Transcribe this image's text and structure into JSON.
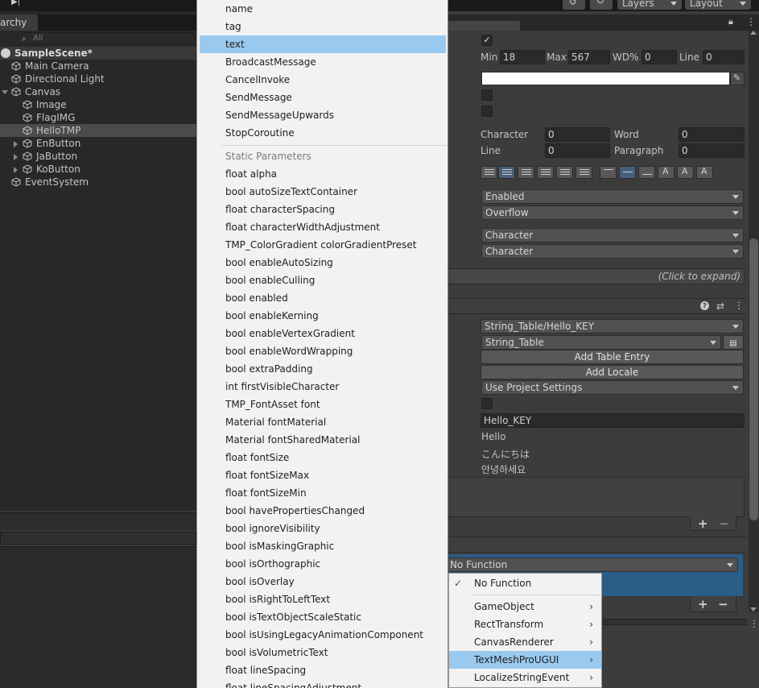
{
  "toolbar": {
    "layers_label": "Layers",
    "layout_label": "Layout"
  },
  "hierarchy": {
    "tab_label": "archy",
    "search_placeholder": "All",
    "items": [
      {
        "label": "SampleScene*"
      },
      {
        "label": "Main Camera"
      },
      {
        "label": "Directional Light"
      },
      {
        "label": "Canvas"
      },
      {
        "label": "Image"
      },
      {
        "label": "FlagIMG"
      },
      {
        "label": "HelloTMP"
      },
      {
        "label": "EnButton"
      },
      {
        "label": "JaButton"
      },
      {
        "label": "KoButton"
      },
      {
        "label": "EventSystem"
      }
    ]
  },
  "inspector": {
    "min_label": "Min",
    "min_value": "18",
    "max_label": "Max",
    "max_value": "567",
    "wd_label": "WD%",
    "wd_value": "0",
    "line_label": "Line",
    "line_value": "0",
    "character_label": "Character",
    "character_value": "0",
    "word_label": "Word",
    "word_value": "0",
    "line2_label": "Line",
    "line2_value": "0",
    "paragraph_label": "Paragraph",
    "paragraph_value": "0",
    "wrapping_value": "Enabled",
    "overflow_value": "Overflow",
    "mapping1_value": "Character",
    "mapping2_value": "Character",
    "click_to_expand": "(Click to expand)",
    "string_ref_value": "String_Table/Hello_KEY",
    "table_value": "String_Table",
    "add_table_entry": "Add Table Entry",
    "add_locale": "Add Locale",
    "project_settings_value": "Use Project Settings",
    "key_value": "Hello_KEY",
    "translation_en": "Hello",
    "translation_ja": "こんにちは",
    "translation_ko": "안녕하세요",
    "no_function_value": "No Function"
  },
  "popup": {
    "items": [
      {
        "label": "name"
      },
      {
        "label": "tag"
      },
      {
        "label": "text"
      },
      {
        "label": "BroadcastMessage"
      },
      {
        "label": "CancelInvoke"
      },
      {
        "label": "SendMessage"
      },
      {
        "label": "SendMessageUpwards"
      },
      {
        "label": "StopCoroutine"
      }
    ],
    "static_header": "Static Parameters",
    "static_items": [
      {
        "label": "float alpha"
      },
      {
        "label": "bool autoSizeTextContainer"
      },
      {
        "label": "float characterSpacing"
      },
      {
        "label": "float characterWidthAdjustment"
      },
      {
        "label": "TMP_ColorGradient colorGradientPreset"
      },
      {
        "label": "bool enableAutoSizing"
      },
      {
        "label": "bool enableCulling"
      },
      {
        "label": "bool enabled"
      },
      {
        "label": "bool enableKerning"
      },
      {
        "label": "bool enableVertexGradient"
      },
      {
        "label": "bool enableWordWrapping"
      },
      {
        "label": "bool extraPadding"
      },
      {
        "label": "int firstVisibleCharacter"
      },
      {
        "label": "TMP_FontAsset font"
      },
      {
        "label": "Material fontMaterial"
      },
      {
        "label": "Material fontSharedMaterial"
      },
      {
        "label": "float fontSize"
      },
      {
        "label": "float fontSizeMax"
      },
      {
        "label": "float fontSizeMin"
      },
      {
        "label": "bool havePropertiesChanged"
      },
      {
        "label": "bool ignoreVisibility"
      },
      {
        "label": "bool isMaskingGraphic"
      },
      {
        "label": "bool isOrthographic"
      },
      {
        "label": "bool isOverlay"
      },
      {
        "label": "bool isRightToLeftText"
      },
      {
        "label": "bool isTextObjectScaleStatic"
      },
      {
        "label": "bool isUsingLegacyAnimationComponent"
      },
      {
        "label": "bool isVolumetricText"
      },
      {
        "label": "float lineSpacing"
      },
      {
        "label": "float lineSpacingAdjustment"
      }
    ]
  },
  "submenu": {
    "items": [
      {
        "label": "No Function"
      },
      {
        "label": "GameObject"
      },
      {
        "label": "RectTransform"
      },
      {
        "label": "CanvasRenderer"
      },
      {
        "label": "TextMeshProUGUI"
      },
      {
        "label": "LocalizeStringEvent"
      }
    ]
  },
  "colors": {
    "highlight": "#99c9ef",
    "event_row": "#2c5d87",
    "panel_bg": "#383838"
  }
}
